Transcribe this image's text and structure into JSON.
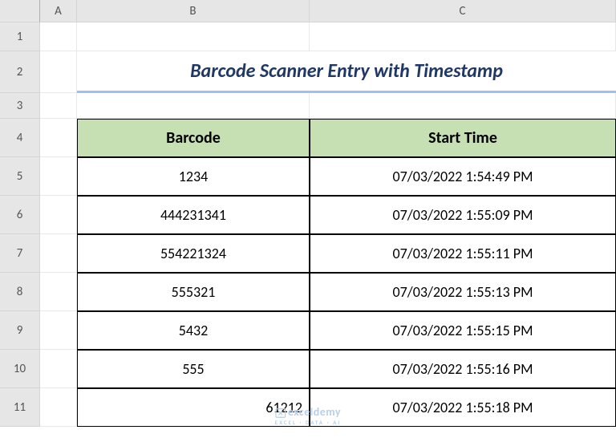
{
  "columns": [
    "",
    "A",
    "B",
    "C"
  ],
  "rows": [
    "1",
    "2",
    "3",
    "4",
    "5",
    "6",
    "7",
    "8",
    "9",
    "10",
    "11"
  ],
  "title": "Barcode Scanner Entry with Timestamp",
  "table": {
    "headers": [
      "Barcode",
      "Start Time"
    ],
    "data": [
      {
        "barcode": "1234",
        "time": "07/03/2022 1:54:49 PM"
      },
      {
        "barcode": "444231341",
        "time": "07/03/2022 1:55:09 PM"
      },
      {
        "barcode": "554221324",
        "time": "07/03/2022 1:55:11 PM"
      },
      {
        "barcode": "555321",
        "time": "07/03/2022 1:55:13 PM"
      },
      {
        "barcode": "5432",
        "time": "07/03/2022 1:55:15 PM"
      },
      {
        "barcode": "555",
        "time": "07/03/2022 1:55:16 PM"
      },
      {
        "barcode": "61212",
        "time": "07/03/2022 1:55:18 PM"
      }
    ]
  },
  "watermark": {
    "main": "exceldemy",
    "sub": "EXCEL · DATA · AI"
  },
  "chart_data": {
    "type": "table",
    "title": "Barcode Scanner Entry with Timestamp",
    "columns": [
      "Barcode",
      "Start Time"
    ],
    "rows": [
      [
        "1234",
        "07/03/2022 1:54:49 PM"
      ],
      [
        "444231341",
        "07/03/2022 1:55:09 PM"
      ],
      [
        "554221324",
        "07/03/2022 1:55:11 PM"
      ],
      [
        "555321",
        "07/03/2022 1:55:13 PM"
      ],
      [
        "5432",
        "07/03/2022 1:55:15 PM"
      ],
      [
        "555",
        "07/03/2022 1:55:16 PM"
      ],
      [
        "61212",
        "07/03/2022 1:55:18 PM"
      ]
    ]
  }
}
